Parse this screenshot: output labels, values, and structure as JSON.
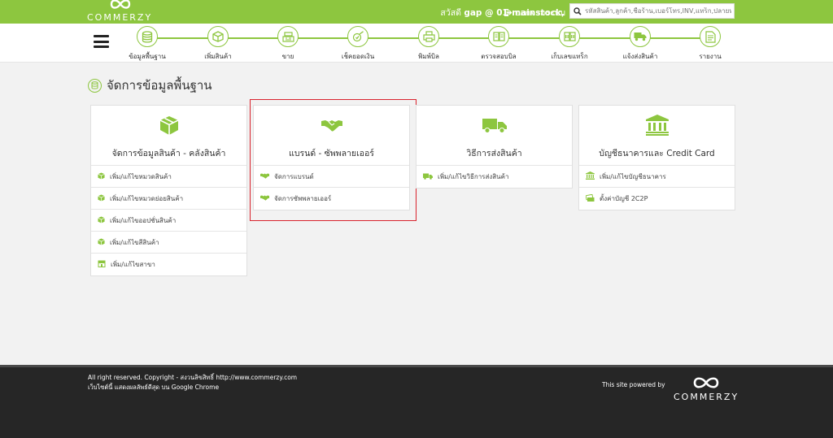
{
  "brand": {
    "name": "COMMERZY"
  },
  "header": {
    "greeting_prefix": "สวัสดี",
    "user": "gap @ 01-mainstock,",
    "logout_label": "ออกจากระบบ",
    "search_placeholder": "รหัสสินค้า,ลูกค้า,ชื่อร้าน,เบอร์โทร,INV,แทร็ก,ปลายทาง"
  },
  "nav": {
    "items": [
      {
        "label": "ข้อมูลพื้นฐาน",
        "icon": "database-icon"
      },
      {
        "label": "เพิ่มสินค้า",
        "icon": "box-icon"
      },
      {
        "label": "ขาย",
        "icon": "cash-register-icon"
      },
      {
        "label": "เช็คยอดเงิน",
        "icon": "money-check-icon"
      },
      {
        "label": "พิมพ์บิล",
        "icon": "printer-icon"
      },
      {
        "label": "ตรวจสอบบิล",
        "icon": "bill-check-icon"
      },
      {
        "label": "เก็บเลขแทร็ก",
        "icon": "tracking-icon"
      },
      {
        "label": "แจ้งส่งสินค้า",
        "icon": "truck-icon"
      },
      {
        "label": "รายงาน",
        "icon": "report-icon"
      }
    ]
  },
  "page": {
    "title": "จัดการข้อมูลพื้นฐาน"
  },
  "cards": [
    {
      "title": "จัดการข้อมูลสินค้า - คลังสินค้า",
      "icon": "box-icon",
      "items": [
        {
          "label": "เพิ่ม/แก้ไขหมวดสินค้า",
          "icon": "box-icon"
        },
        {
          "label": "เพิ่ม/แก้ไขหมวดย่อยสินค้า",
          "icon": "box-icon"
        },
        {
          "label": "เพิ่ม/แก้ไขออปชั่นสินค้า",
          "icon": "box-icon"
        },
        {
          "label": "เพิ่ม/แก้ไขสีสินค้า",
          "icon": "box-icon"
        },
        {
          "label": "เพิ่ม/แก้ไขสาขา",
          "icon": "store-icon"
        }
      ]
    },
    {
      "title": "แบรนด์ - ซัพพลายเออร์",
      "icon": "handshake-icon",
      "items": [
        {
          "label": "จัดการแบรนด์",
          "icon": "handshake-icon"
        },
        {
          "label": "จัดการซัพพลายเออร์",
          "icon": "handshake-icon"
        }
      ]
    },
    {
      "title": "วิธีการส่งสินค้า",
      "icon": "truck-icon",
      "items": [
        {
          "label": "เพิ่ม/แก้ไขวิธีการส่งสินค้า",
          "icon": "truck-icon"
        }
      ]
    },
    {
      "title": "บัญชีธนาคารและ Credit Card",
      "icon": "bank-icon",
      "items": [
        {
          "label": "เพิ่ม/แก้ไขบัญชีธนาคาร",
          "icon": "bank-icon"
        },
        {
          "label": "ตั้งค่าบัญชี 2C2P",
          "icon": "money-icon"
        }
      ]
    }
  ],
  "footer": {
    "copyright_line1": "All right reserved. Copyright - สงวนลิขสิทธิ์ http://www.commerzy.com",
    "copyright_line2": "เว็บไซต์นี้ แสดงผลลัพธ์ดีสุด บน Google Chrome",
    "powered_by": "This site powered by",
    "brand": "COMMERZY"
  },
  "colors": {
    "accent": "#8dc63f",
    "highlight": "#d9232d",
    "footer": "#262626"
  }
}
